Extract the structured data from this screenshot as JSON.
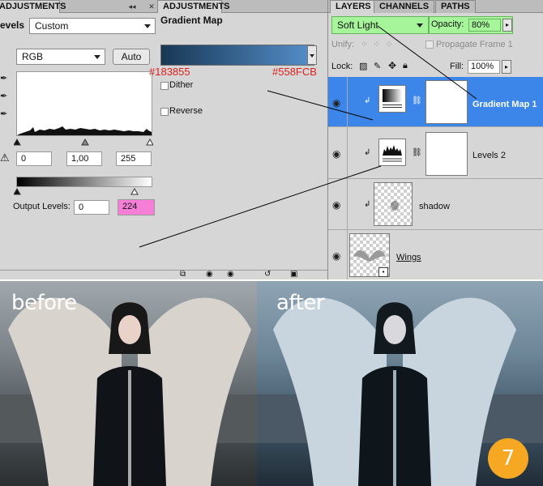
{
  "levels_panel": {
    "tab_label": "ADJUSTMENTS",
    "title": "evels",
    "preset": "Custom",
    "channel": "RGB",
    "auto_label": "Auto",
    "input_black": "0",
    "input_gamma": "1,00",
    "input_white": "255",
    "output_label": "Output Levels:",
    "output_black": "0",
    "output_white": "224"
  },
  "gradient_panel": {
    "tab_label": "ADJUSTMENTS",
    "title": "Gradient Map",
    "color_left": "#183855",
    "color_right": "#558FCB",
    "dither_label": "Dither",
    "reverse_label": "Reverse"
  },
  "layers_panel": {
    "tabs": [
      "LAYERS",
      "CHANNELS",
      "PATHS"
    ],
    "blend_mode": "Soft Light",
    "opacity_label": "Opacity:",
    "opacity_value": "80%",
    "unify_label": "Unify:",
    "propagate_label": "Propagate Frame 1",
    "lock_label": "Lock:",
    "fill_label": "Fill:",
    "fill_value": "100%",
    "layers": [
      {
        "name": "Gradient Map 1",
        "selected": true
      },
      {
        "name": "Levels 2",
        "selected": false
      },
      {
        "name": "shadow",
        "selected": false
      },
      {
        "name": "Wings",
        "selected": false
      }
    ]
  },
  "comparison": {
    "before_label": "before",
    "after_label": "after",
    "step_number": "7"
  },
  "colors": {
    "highlight_green": "#a6f59a",
    "output_pink": "#f57fd6",
    "annotation_red": "#e0201c",
    "selection_blue": "#3b86e8",
    "step_orange": "#f7a823"
  }
}
